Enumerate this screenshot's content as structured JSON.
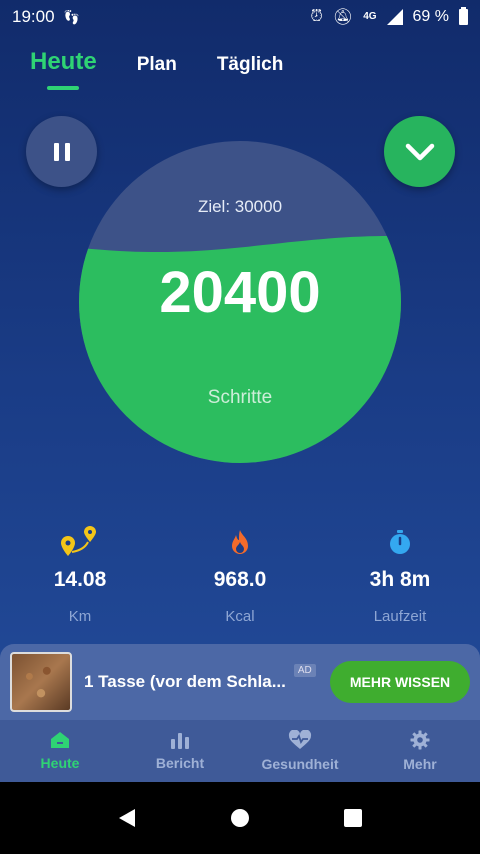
{
  "status_bar": {
    "time": "19:00",
    "network": "4G",
    "battery": "69 %"
  },
  "tabs": [
    {
      "label": "Heute",
      "active": true
    },
    {
      "label": "Plan",
      "active": false
    },
    {
      "label": "Täglich",
      "active": false
    }
  ],
  "gauge": {
    "goal_label": "Ziel: 30000",
    "steps": "20400",
    "unit": "Schritte",
    "progress": 0.68
  },
  "stats": [
    {
      "icon": "map-pin-route-icon",
      "value": "14.08",
      "label": "Km"
    },
    {
      "icon": "flame-icon",
      "value": "968.0",
      "label": "Kcal"
    },
    {
      "icon": "stopwatch-icon",
      "value": "3h 8m",
      "label": "Laufzeit"
    }
  ],
  "ad": {
    "title": "1 Tasse (vor dem Schla...",
    "badge": "AD",
    "cta": "MEHR WISSEN"
  },
  "bottom_nav": [
    {
      "icon": "home-icon",
      "label": "Heute",
      "active": true
    },
    {
      "icon": "bar-chart-icon",
      "label": "Bericht",
      "active": false
    },
    {
      "icon": "heart-pulse-icon",
      "label": "Gesundheit",
      "active": false
    },
    {
      "icon": "gear-icon",
      "label": "Mehr",
      "active": false
    }
  ],
  "colors": {
    "accent": "#2fd374",
    "gauge_fill": "#2cbd5f",
    "gauge_empty": "#3d5288",
    "background_top": "#112b6b",
    "cta": "#3fad2f"
  }
}
